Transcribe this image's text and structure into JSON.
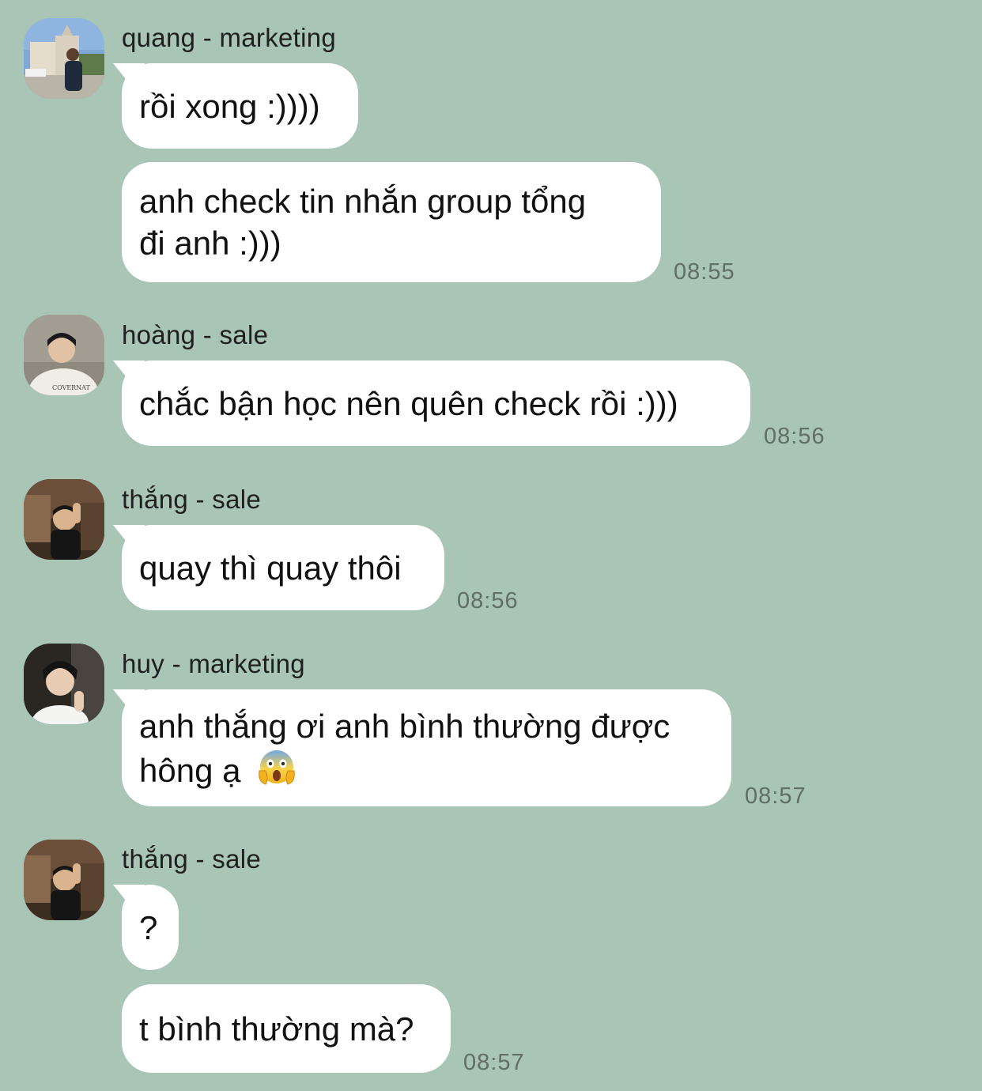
{
  "chat": {
    "messages": [
      {
        "sender": "quang - marketing",
        "avatar_icon": "avatar-quang",
        "bubbles": [
          "rồi xong :))))",
          "anh check tin nhắn group tổng",
          "đi anh :)))"
        ],
        "time": "08:55"
      },
      {
        "sender": "hoàng - sale",
        "avatar_icon": "avatar-hoang",
        "bubbles": [
          "chắc bận học nên quên check rồi :)))"
        ],
        "time": "08:56"
      },
      {
        "sender": "thắng - sale",
        "avatar_icon": "avatar-thang",
        "bubbles": [
          "quay thì quay thôi"
        ],
        "time": "08:56"
      },
      {
        "sender": "huy - marketing",
        "avatar_icon": "avatar-huy",
        "bubbles": [
          "anh thắng ơi anh bình thường được",
          "hông ạ"
        ],
        "emoji": "face-screaming-in-fear",
        "time": "08:57"
      },
      {
        "sender": "thắng - sale",
        "avatar_icon": "avatar-thang",
        "bubbles": [
          "?",
          "t bình thường mà?"
        ],
        "time": "08:57"
      }
    ]
  },
  "colors": {
    "background": "#a8c5b6",
    "bubble": "#ffffff",
    "timestamp": "#5f6e66"
  }
}
